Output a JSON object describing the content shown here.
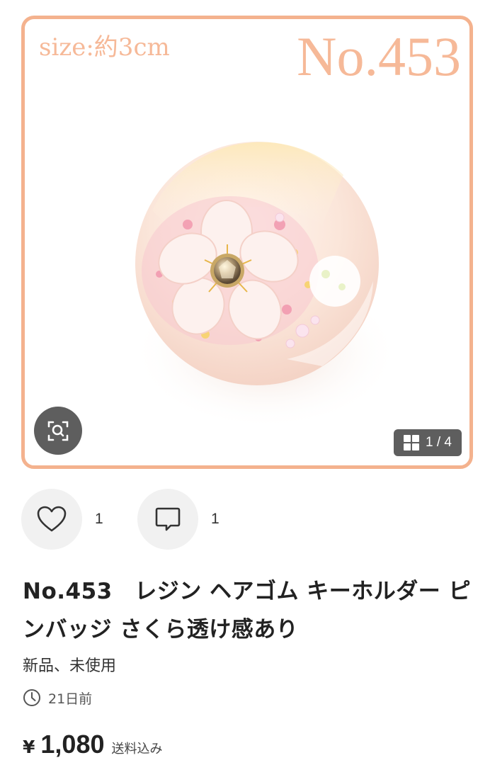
{
  "product_image": {
    "size_text": "size:約3cm",
    "number_text": "No.453",
    "frame_color": "#f4b28e",
    "photo_subject": "resin-sakura-hair-tie"
  },
  "gallery": {
    "zoom_icon": "zoom-scan-icon",
    "counter_icon": "grid-icon",
    "counter": "1 / 4"
  },
  "actions": {
    "like_icon": "heart-icon",
    "like_count": "1",
    "comment_icon": "comment-icon",
    "comment_count": "1"
  },
  "product": {
    "title": "No.453　レジン ヘアゴム キーホルダー ピンバッジ さくら透け感あり",
    "condition": "新品、未使用",
    "posted_icon": "clock-icon",
    "posted": "21日前",
    "currency": "¥",
    "price": "1,080",
    "shipping": "送料込み"
  }
}
